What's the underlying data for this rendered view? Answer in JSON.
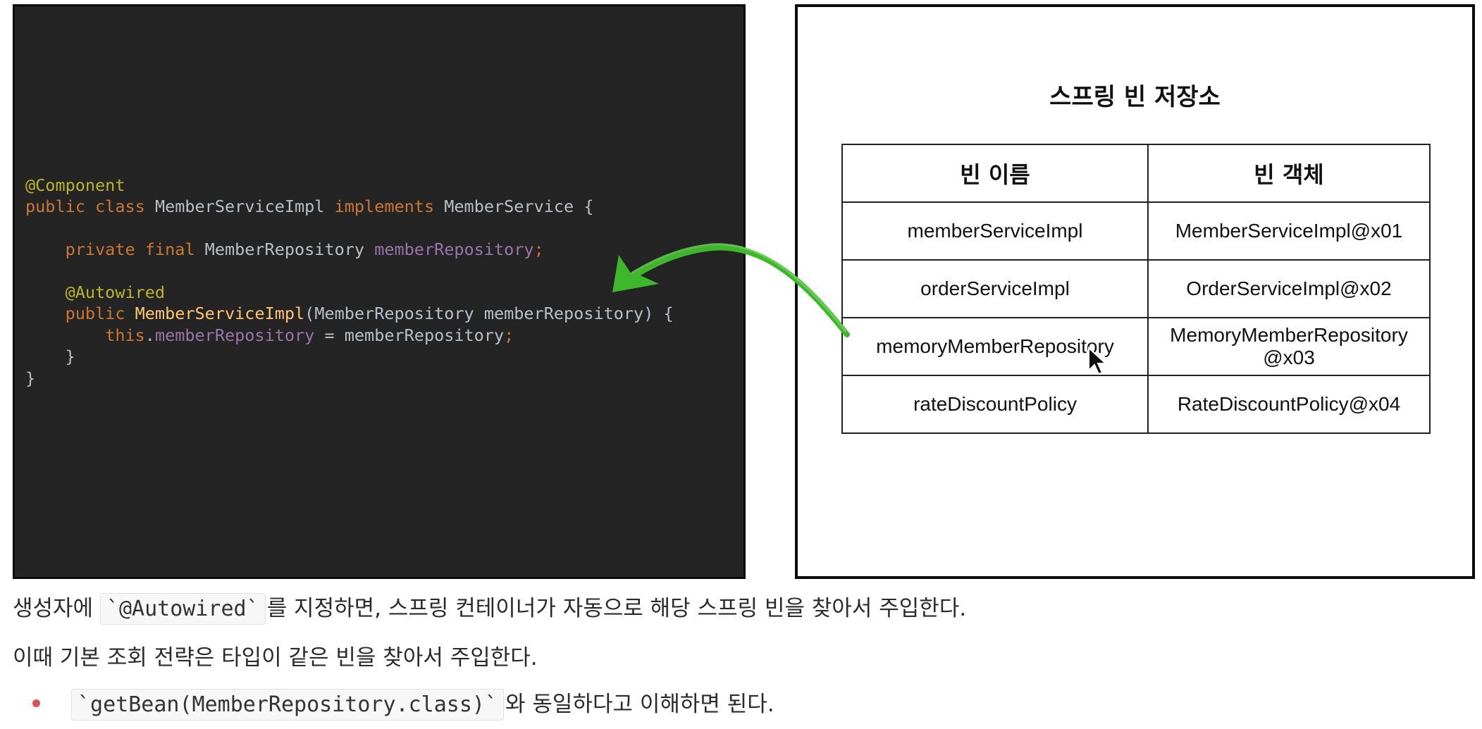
{
  "code": {
    "line1": "@Component",
    "line2": {
      "kw": "public class ",
      "cls": "MemberServiceImpl ",
      "kw2": "implements ",
      "iface": "MemberService {"
    },
    "line3": {
      "kw": "private final ",
      "type": "MemberRepository ",
      "field": "memberRepository",
      "end": ";"
    },
    "line4": "@Autowired",
    "line5": {
      "kw": "public ",
      "ctor": "MemberServiceImpl",
      "params": "(MemberRepository memberRepository) {"
    },
    "line6": {
      "kw": "this",
      "dot": ".",
      "field": "memberRepository",
      "rest": " = memberRepository",
      "end": ";"
    },
    "line7": "}",
    "line8": "}"
  },
  "container": {
    "title": "스프링 빈 저장소",
    "headers": [
      "빈 이름",
      "빈 객체"
    ],
    "rows": [
      {
        "name": "memberServiceImpl",
        "object": "MemberServiceImpl@x01"
      },
      {
        "name": "orderServiceImpl",
        "object": "OrderServiceImpl@x02"
      },
      {
        "name": "memoryMemberRepository",
        "object_line1": "MemoryMemberRepository",
        "object_line2": "@x03"
      },
      {
        "name": "rateDiscountPolicy",
        "object": "RateDiscountPolicy@x04"
      }
    ]
  },
  "prose": {
    "line1_before": "생성자에 ",
    "line1_code": "`@Autowired`",
    "line1_after": "를 지정하면, 스프링 컨테이너가 자동으로 해당 스프링 빈을 찾아서 주입한다.",
    "line2": "이때 기본 조회 전략은 타입이 같은 빈을 찾아서 주입한다.",
    "line3_code": "`getBean(MemberRepository.class)`",
    "line3_after": "와 동일하다고 이해하면 된다."
  },
  "colors": {
    "arrow": "#3db82b",
    "bullet": "#d9534f",
    "code_bg": "#242424"
  },
  "icons": {
    "cursor": "mouse-pointer-icon",
    "arrow": "curved-arrow-icon"
  }
}
